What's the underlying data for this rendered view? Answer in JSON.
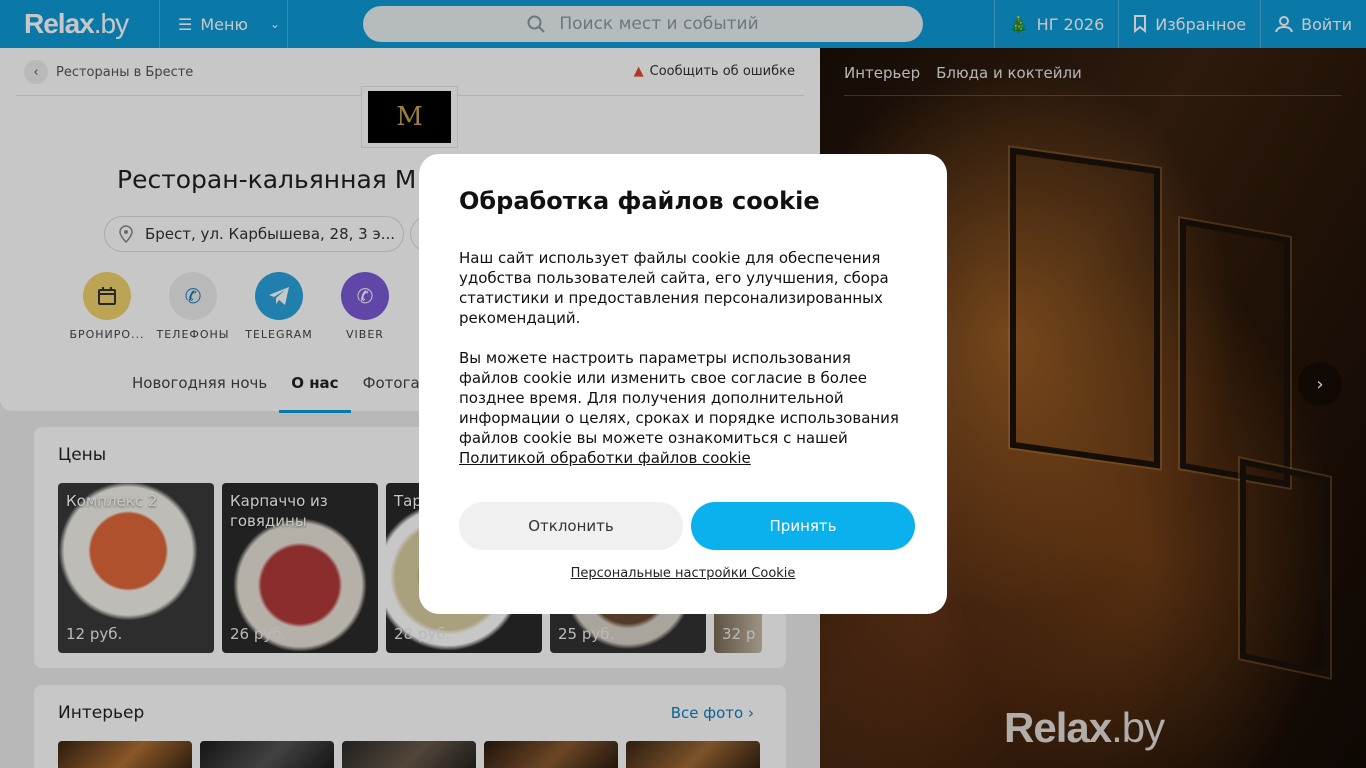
{
  "header": {
    "logo_main": "Relax",
    "logo_dot": ".by",
    "menu_label": "Меню",
    "search_placeholder": "Поиск мест и событий",
    "ny_label": "НГ 2026",
    "favorites_label": "Избранное",
    "login_label": "Войти"
  },
  "breadcrumb": {
    "back_label": "Рестораны в Бресте"
  },
  "report_label": "Сообщить об ошибке",
  "venue": {
    "logo_letter": "M",
    "title": "Ресторан-кальянная M.",
    "address": "Брест, ул. Карбышева, 28, 3 э..."
  },
  "actions": [
    {
      "label": "БРОНИРО...",
      "icon": "calendar-icon",
      "color": "#f0d36b"
    },
    {
      "label": "ТЕЛЕФОНЫ",
      "icon": "phone-icon",
      "color": "#eeeeee"
    },
    {
      "label": "TELEGRAM",
      "icon": "telegram-icon",
      "color": "#2aa3dd"
    },
    {
      "label": "VIBER",
      "icon": "viber-icon",
      "color": "#7b5cd6"
    }
  ],
  "tabs": [
    "Новогодняя ночь",
    "О нас",
    "Фотогалерея"
  ],
  "prices": {
    "title": "Цены",
    "items": [
      {
        "name": "Комплекс 2",
        "price": "12 руб."
      },
      {
        "name": "Карпаччо из говядины",
        "price": "26 руб."
      },
      {
        "name": "Тар",
        "price": "28 руб."
      },
      {
        "name": "",
        "price": "25 руб."
      },
      {
        "name": "",
        "price": "32 р"
      }
    ]
  },
  "interior": {
    "title": "Интерьер",
    "all_photos": "Все фото"
  },
  "gallery": {
    "tabs": [
      "Интерьер",
      "Блюда и коктейли"
    ],
    "watermark_main": "Relax",
    "watermark_dot": ".by"
  },
  "cookie": {
    "title": "Обработка файлов cookie",
    "p1": "Наш сайт использует файлы cookie для обеспечения удобства пользователей сайта, его улучшения, сбора статистики и предоставления персонализированных рекомендаций.",
    "p2": "Вы можете настроить параметры использования файлов cookie или изменить свое согласие в более позднее время. Для получения дополнительной информации о целях, сроках и порядке использования файлов cookie вы можете ознакомиться с нашей",
    "policy_link": "Политикой обработки файлов cookie",
    "decline": "Отклонить",
    "accept": "Принять",
    "personal": "Персональные настройки Cookie"
  },
  "colors": {
    "brand": "#0d9bd6",
    "accept": "#0ab1ec"
  }
}
